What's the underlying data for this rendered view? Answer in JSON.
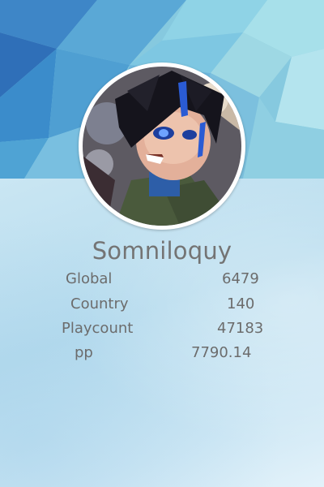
{
  "profile": {
    "username": "Somniloquy"
  },
  "stats": [
    {
      "label": "Global",
      "value": "6479"
    },
    {
      "label": "Country",
      "value": "140"
    },
    {
      "label": "Playcount",
      "value": "47183"
    },
    {
      "label": "pp",
      "value": "7790.14"
    }
  ],
  "colors": {
    "text": "#6c6c6c",
    "username": "#747474",
    "banner_base": "#7fc4dc",
    "card_bg": "#c6e4f2",
    "avatar_ring": "#ffffff"
  }
}
